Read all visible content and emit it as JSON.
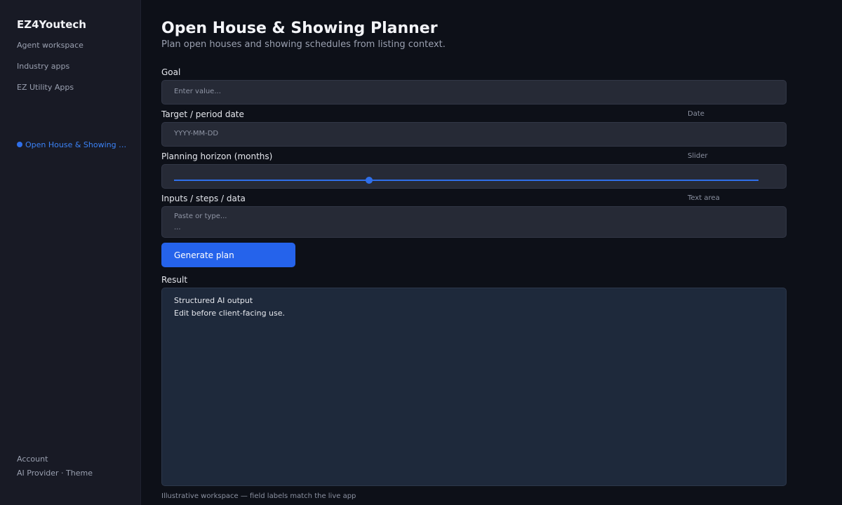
{
  "sidebar": {
    "brand": "EZ4Youtech",
    "nav_items": [
      "Agent workspace",
      "Industry apps",
      "EZ Utility Apps"
    ],
    "active_item": "Open House & Showing Planner",
    "footer": {
      "account": "Account",
      "provider_theme": "AI Provider · Theme"
    }
  },
  "main": {
    "title": "Open House & Showing Planner",
    "subtitle": "Plan open houses and showing schedules from listing context.",
    "fields": {
      "goal": {
        "label": "Goal",
        "placeholder": "Enter value..."
      },
      "date": {
        "label": "Target / period date",
        "type": "Date",
        "placeholder": "YYYY-MM-DD"
      },
      "horizon": {
        "label": "Planning horizon (months)",
        "type": "Slider",
        "value_fraction": 0.334
      },
      "inputs": {
        "label": "Inputs / steps / data",
        "type": "Text area",
        "placeholder_line1": "Paste or type...",
        "placeholder_line2": "..."
      }
    },
    "generate_button": "Generate plan",
    "result": {
      "label": "Result",
      "line1": "Structured AI output",
      "line2": "Edit before client-facing use."
    },
    "footnote": "Illustrative workspace — field labels match the live app"
  }
}
